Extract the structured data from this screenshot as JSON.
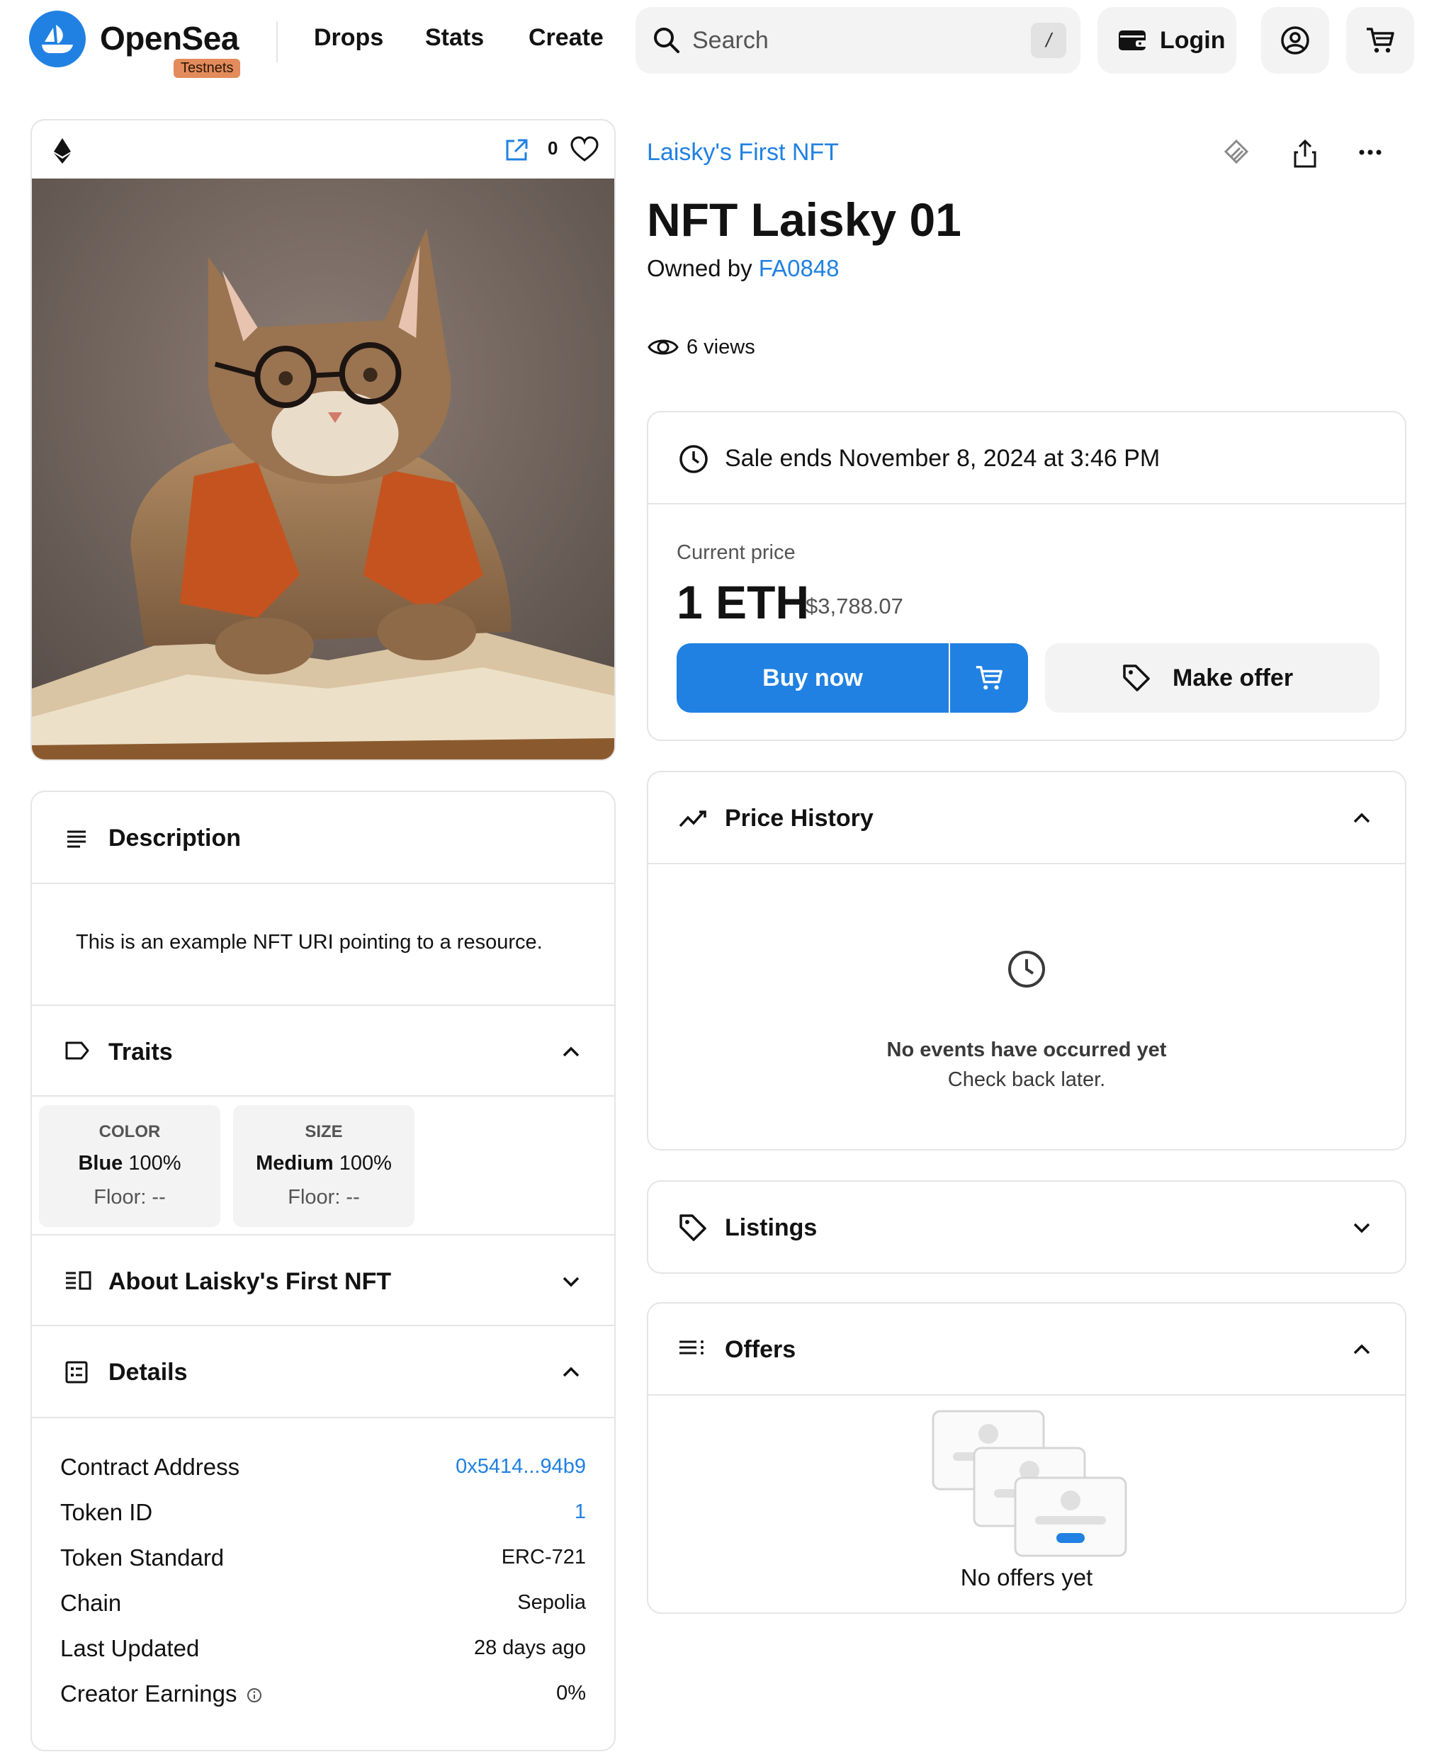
{
  "nav": {
    "brand": "OpenSea",
    "badge": "Testnets",
    "links": [
      "Drops",
      "Stats",
      "Create"
    ],
    "search_placeholder": "Search",
    "search_shortcut": "/",
    "login_label": "Login",
    "icons": [
      "profile-icon",
      "cart-icon"
    ]
  },
  "media": {
    "chain_icon": "ethereum-icon",
    "favorites_count": "0",
    "image_description": "cat wearing glasses and orange vest reading a book"
  },
  "description": {
    "title": "Description",
    "text": "This is an example NFT URI pointing to a resource."
  },
  "traits": {
    "title": "Traits",
    "items": [
      {
        "type": "COLOR",
        "value": "Blue",
        "percent": "100%",
        "floor": "Floor: --"
      },
      {
        "type": "SIZE",
        "value": "Medium",
        "percent": "100%",
        "floor": "Floor: --"
      }
    ]
  },
  "about": {
    "title": "About Laisky's First NFT"
  },
  "details": {
    "title": "Details",
    "rows": [
      {
        "label": "Contract Address",
        "value": "0x5414...94b9"
      },
      {
        "label": "Token ID",
        "value": "1"
      },
      {
        "label": "Token Standard",
        "value": "ERC-721"
      },
      {
        "label": "Chain",
        "value": "Sepolia"
      },
      {
        "label": "Last Updated",
        "value": "28 days ago"
      },
      {
        "label": "Creator Earnings",
        "value": "0%"
      }
    ]
  },
  "item": {
    "collection": "Laisky's First NFT",
    "name": "NFT Laisky 01",
    "owned_by_prefix": "Owned by",
    "owner": "FA0848",
    "views": "6 views"
  },
  "sale": {
    "ends": "Sale ends November 8, 2024 at 3:46 PM",
    "price_label": "Current price",
    "price": "1 ETH",
    "price_usd": "$3,788.07",
    "buy_label": "Buy now",
    "offer_label": "Make offer"
  },
  "price_history": {
    "title": "Price History",
    "empty_title": "No events have occurred yet",
    "empty_sub": "Check back later."
  },
  "listings": {
    "title": "Listings"
  },
  "offers": {
    "title": "Offers",
    "empty": "No offers yet"
  },
  "colors": {
    "accent": "#2081e2",
    "badge": "#e38b5a",
    "border": "#e5e5e5",
    "muted_bg": "#f3f3f3"
  }
}
